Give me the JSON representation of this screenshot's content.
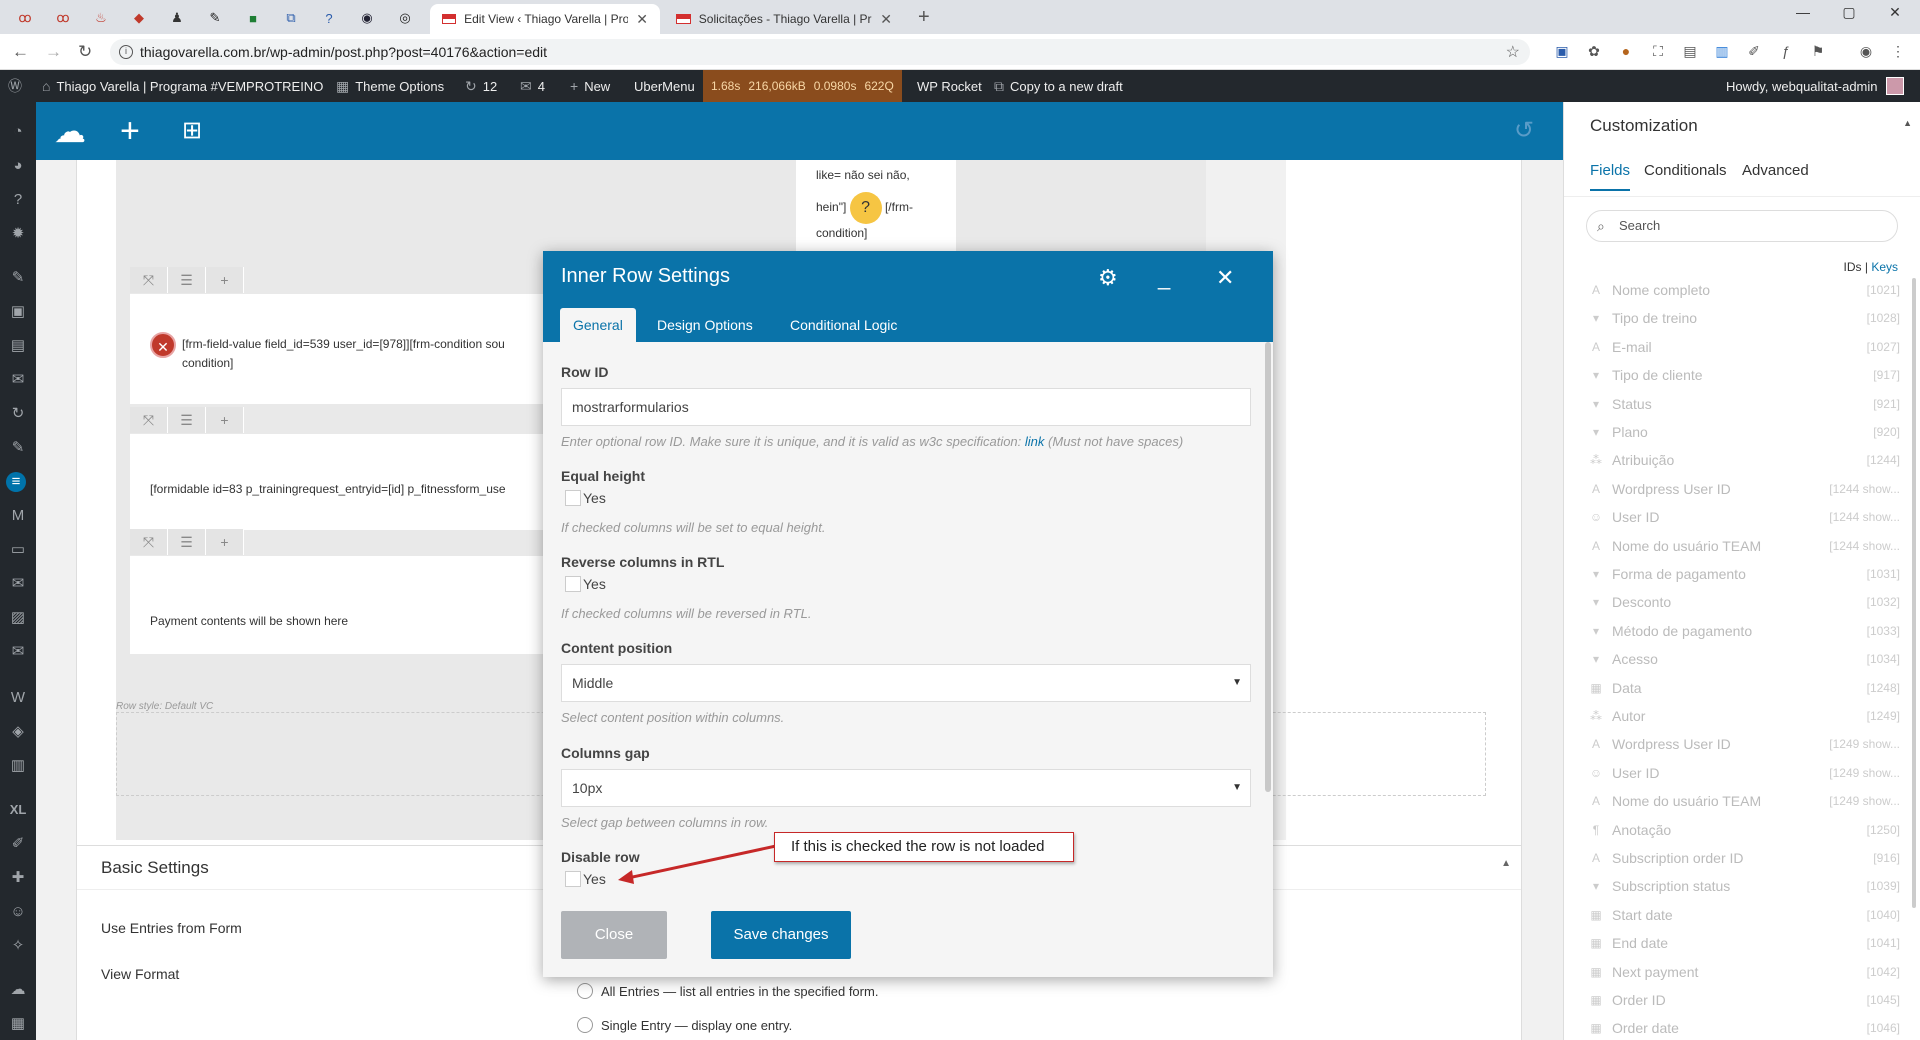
{
  "browser": {
    "tabs": [
      {
        "title": "Edit View ‹ Thiago Varella | Progr",
        "active": true
      },
      {
        "title": "Solicitações - Thiago Varella | Pr",
        "active": false
      }
    ],
    "url": "thiagovarella.com.br/wp-admin/post.php?post=40176&action=edit"
  },
  "adminbar": {
    "site": "Thiago Varella | Programa #VEMPROTREINO",
    "theme_options": "Theme Options",
    "updates": "12",
    "comments": "4",
    "new": "New",
    "ubermenu": "UberMenu",
    "stats": [
      "1.68s",
      "216,066kB",
      "0.0980s",
      "622Q"
    ],
    "wp_rocket": "WP Rocket",
    "copy_draft": "Copy to a new draft",
    "howdy": "Howdy, webqualitat-admin"
  },
  "canvas": {
    "top_text": "like= não sei não,",
    "hein_text": "hein\"]",
    "frm_close": "[/frm-",
    "frm_close2": "condition]",
    "row1_text": "[frm-field-value field_id=539 user_id=[978]][frm-condition sou",
    "row1_text2": "condition]",
    "row2_text": "[formidable id=83 p_trainingrequest_entryid=[id] p_fitnessform_use",
    "row3_text": "Payment contents will be shown here",
    "row_style": "Row style: Default VC",
    "basic_settings": "Basic Settings",
    "use_entries": "Use Entries from Form",
    "view_format": "View Format",
    "radio_all": "All Entries — list all entries in the specified form.",
    "radio_single": "Single Entry — display one entry."
  },
  "modal": {
    "title": "Inner Row Settings",
    "tabs": [
      "General",
      "Design Options",
      "Conditional Logic"
    ],
    "row_id_label": "Row ID",
    "row_id_value": "mostrarformularios",
    "row_id_help": "Enter optional row ID. Make sure it is unique, and it is valid as w3c specification:",
    "row_id_link": "link",
    "row_id_help2": "(Must not have spaces)",
    "equal_height_label": "Equal height",
    "yes": "Yes",
    "equal_height_help": "If checked columns will be set to equal height.",
    "reverse_label": "Reverse columns in RTL",
    "reverse_help": "If checked columns will be reversed in RTL.",
    "content_pos_label": "Content position",
    "content_pos_value": "Middle",
    "content_pos_help": "Select content position within columns.",
    "gap_label": "Columns gap",
    "gap_value": "10px",
    "gap_help": "Select gap between columns in row.",
    "disable_label": "Disable row",
    "close": "Close",
    "save": "Save changes"
  },
  "callout": "If this is checked the row is not loaded",
  "sidebar": {
    "title": "Customization",
    "tabs": [
      "Fields",
      "Conditionals",
      "Advanced"
    ],
    "search_placeholder": "Search",
    "ids": "IDs",
    "sep": "|",
    "keys": "Keys",
    "items": [
      {
        "icon": "A",
        "name": "Nome completo",
        "id": "[1021]"
      },
      {
        "icon": "▾",
        "name": "Tipo de treino",
        "id": "[1028]"
      },
      {
        "icon": "A",
        "name": "E-mail",
        "id": "[1027]"
      },
      {
        "icon": "▾",
        "name": "Tipo de cliente",
        "id": "[917]"
      },
      {
        "icon": "▾",
        "name": "Status",
        "id": "[921]"
      },
      {
        "icon": "▾",
        "name": "Plano",
        "id": "[920]"
      },
      {
        "icon": "⁂",
        "name": "Atribuição",
        "id": "[1244]"
      },
      {
        "icon": "A",
        "name": "Wordpress User ID",
        "id": "[1244 show..."
      },
      {
        "icon": "☺",
        "name": "User ID",
        "id": "[1244 show..."
      },
      {
        "icon": "A",
        "name": "Nome do usuário TEAM",
        "id": "[1244 show..."
      },
      {
        "icon": "▾",
        "name": "Forma de pagamento",
        "id": "[1031]"
      },
      {
        "icon": "▾",
        "name": "Desconto",
        "id": "[1032]"
      },
      {
        "icon": "▾",
        "name": "Método de pagamento",
        "id": "[1033]"
      },
      {
        "icon": "▾",
        "name": "Acesso",
        "id": "[1034]"
      },
      {
        "icon": "▦",
        "name": "Data",
        "id": "[1248]"
      },
      {
        "icon": "⁂",
        "name": "Autor",
        "id": "[1249]"
      },
      {
        "icon": "A",
        "name": "Wordpress User ID",
        "id": "[1249 show..."
      },
      {
        "icon": "☺",
        "name": "User ID",
        "id": "[1249 show..."
      },
      {
        "icon": "A",
        "name": "Nome do usuário TEAM",
        "id": "[1249 show..."
      },
      {
        "icon": "¶",
        "name": "Anotação",
        "id": "[1250]"
      },
      {
        "icon": "A",
        "name": "Subscription order ID",
        "id": "[916]"
      },
      {
        "icon": "▾",
        "name": "Subscription status",
        "id": "[1039]"
      },
      {
        "icon": "▦",
        "name": "Start date",
        "id": "[1040]"
      },
      {
        "icon": "▦",
        "name": "End date",
        "id": "[1041]"
      },
      {
        "icon": "▦",
        "name": "Next payment",
        "id": "[1042]"
      },
      {
        "icon": "▦",
        "name": "Order ID",
        "id": "[1045]"
      },
      {
        "icon": "▦",
        "name": "Order date",
        "id": "[1046]"
      }
    ]
  }
}
